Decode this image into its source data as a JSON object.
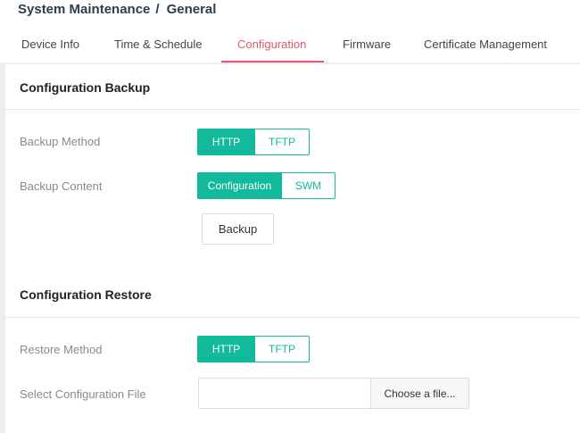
{
  "breadcrumb": {
    "section": "System Maintenance",
    "separator": "/",
    "page": "General"
  },
  "tabs": [
    {
      "label": "Device Info",
      "active": false
    },
    {
      "label": "Time & Schedule",
      "active": false
    },
    {
      "label": "Configuration",
      "active": true
    },
    {
      "label": "Firmware",
      "active": false
    },
    {
      "label": "Certificate Management",
      "active": false
    }
  ],
  "backup": {
    "title": "Configuration Backup",
    "method_label": "Backup Method",
    "method_options": [
      "HTTP",
      "TFTP"
    ],
    "method_selected": "HTTP",
    "content_label": "Backup Content",
    "content_options": [
      "Configuration",
      "SWM"
    ],
    "content_selected": "Configuration",
    "button_label": "Backup"
  },
  "restore": {
    "title": "Configuration Restore",
    "method_label": "Restore Method",
    "method_options": [
      "HTTP",
      "TFTP"
    ],
    "method_selected": "HTTP",
    "file_label": "Select Configuration File",
    "file_value": "",
    "file_button_label": "Choose a file..."
  },
  "colors": {
    "accent": "#12b99a",
    "active_tab": "#e2566d",
    "background": "#ededf0"
  }
}
